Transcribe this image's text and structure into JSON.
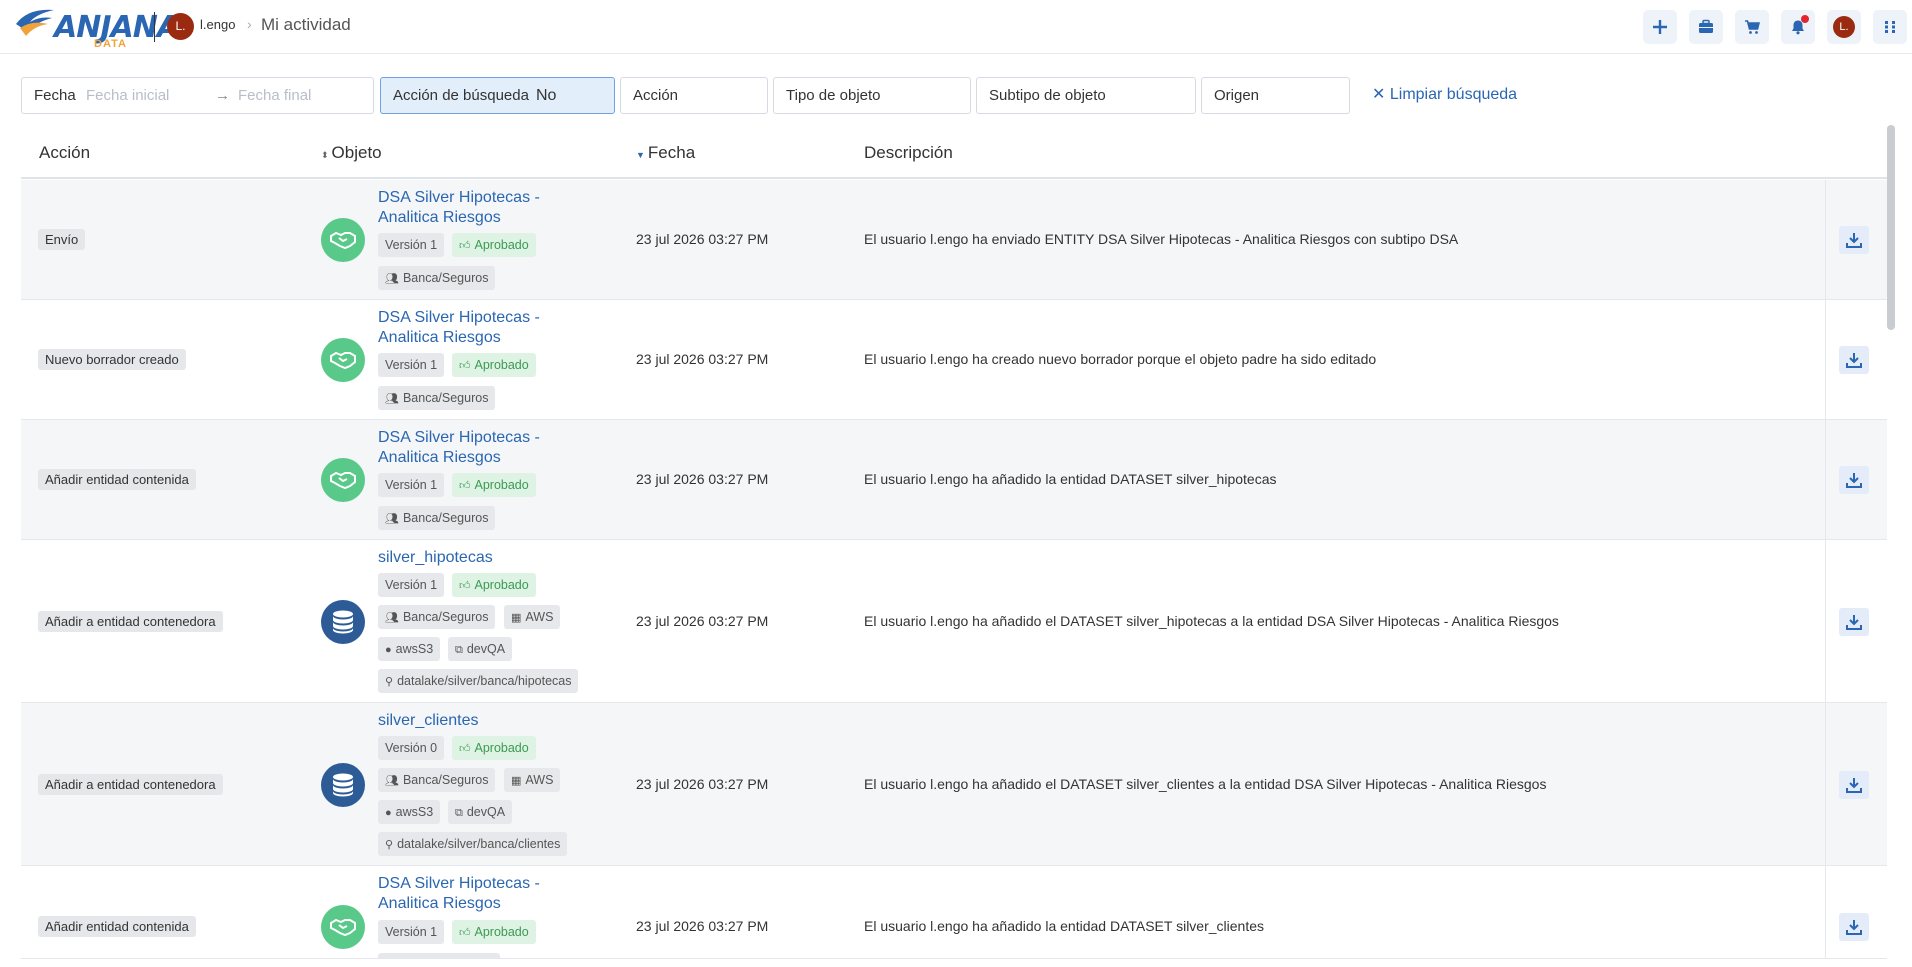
{
  "header": {
    "logo_text": "ANJANA",
    "logo_sub": "DATA",
    "user_initial": "L.",
    "user_name": "l.engo",
    "page_title": "Mi actividad",
    "avatar_initial": "L."
  },
  "filters": {
    "date_label": "Fecha",
    "date_start_placeholder": "Fecha inicial",
    "date_end_placeholder": "Fecha final",
    "search_action_label": "Acción de búsqueda",
    "search_action_value": "No",
    "action_label": "Acción",
    "object_type_label": "Tipo de objeto",
    "object_subtype_label": "Subtipo de objeto",
    "origin_label": "Origen",
    "clear_label": "Limpiar búsqueda"
  },
  "table": {
    "columns": {
      "action": "Acción",
      "object": "Objeto",
      "date": "Fecha",
      "description": "Descripción"
    },
    "rows": [
      {
        "action": "Envío",
        "title_1": "DSA Silver Hipotecas -",
        "title_2": "Analitica Riesgos",
        "version": "Versión 1",
        "status": "Aprobado",
        "domain": "Banca/Seguros",
        "date": "23 jul 2026 03:27 PM",
        "description": "El usuario l.engo ha enviado ENTITY DSA Silver Hipotecas - Analitica Riesgos con subtipo DSA"
      },
      {
        "action": "Nuevo borrador creado",
        "title_1": "DSA Silver Hipotecas -",
        "title_2": "Analitica Riesgos",
        "version": "Versión 1",
        "status": "Aprobado",
        "domain": "Banca/Seguros",
        "date": "23 jul 2026 03:27 PM",
        "description": "El usuario l.engo ha creado nuevo borrador porque el objeto padre ha sido editado"
      },
      {
        "action": "Añadir entidad contenida",
        "title_1": "DSA Silver Hipotecas -",
        "title_2": "Analitica Riesgos",
        "version": "Versión 1",
        "status": "Aprobado",
        "domain": "Banca/Seguros",
        "date": "23 jul 2026 03:27 PM",
        "description": "El usuario l.engo ha añadido la entidad DATASET silver_hipotecas"
      },
      {
        "action": "Añadir a entidad contenedora",
        "title_1": "silver_hipotecas",
        "version": "Versión 1",
        "status": "Aprobado",
        "domain": "Banca/Seguros",
        "infra": "AWS",
        "tech": "awsS3",
        "env": "devQA",
        "path": "datalake/silver/banca/hipotecas",
        "date": "23 jul 2026 03:27 PM",
        "description": "El usuario l.engo ha añadido el DATASET silver_hipotecas a la entidad DSA Silver Hipotecas - Analitica Riesgos"
      },
      {
        "action": "Añadir a entidad contenedora",
        "title_1": "silver_clientes",
        "version": "Versión 0",
        "status": "Aprobado",
        "domain": "Banca/Seguros",
        "infra": "AWS",
        "tech": "awsS3",
        "env": "devQA",
        "path": "datalake/silver/banca/clientes",
        "date": "23 jul 2026 03:27 PM",
        "description": "El usuario l.engo ha añadido el DATASET silver_clientes a la entidad DSA Silver Hipotecas - Analitica Riesgos"
      },
      {
        "action": "Añadir entidad contenida",
        "title_1": "DSA Silver Hipotecas -",
        "title_2": "Analitica Riesgos",
        "version": "Versión 1",
        "status": "Aprobado",
        "date": "23 jul 2026 03:27 PM",
        "description": "El usuario l.engo ha añadido la entidad DATASET silver_clientes"
      }
    ]
  },
  "colors": {
    "primary": "#2a66b1",
    "approved_bg": "#dff3e4",
    "approved_text": "#3b9a52",
    "dsa_icon": "#59c98a",
    "dataset_icon": "#2c5b96",
    "notification": "#e0262e"
  },
  "icons": [
    "plus-icon",
    "briefcase-icon",
    "cart-icon",
    "bell-icon",
    "apps-grid-icon",
    "handshake-icon",
    "database-icon",
    "download-icon",
    "thumbs-up-icon",
    "users-icon",
    "building-icon",
    "bulb-icon",
    "network-icon",
    "location-pin-icon"
  ]
}
